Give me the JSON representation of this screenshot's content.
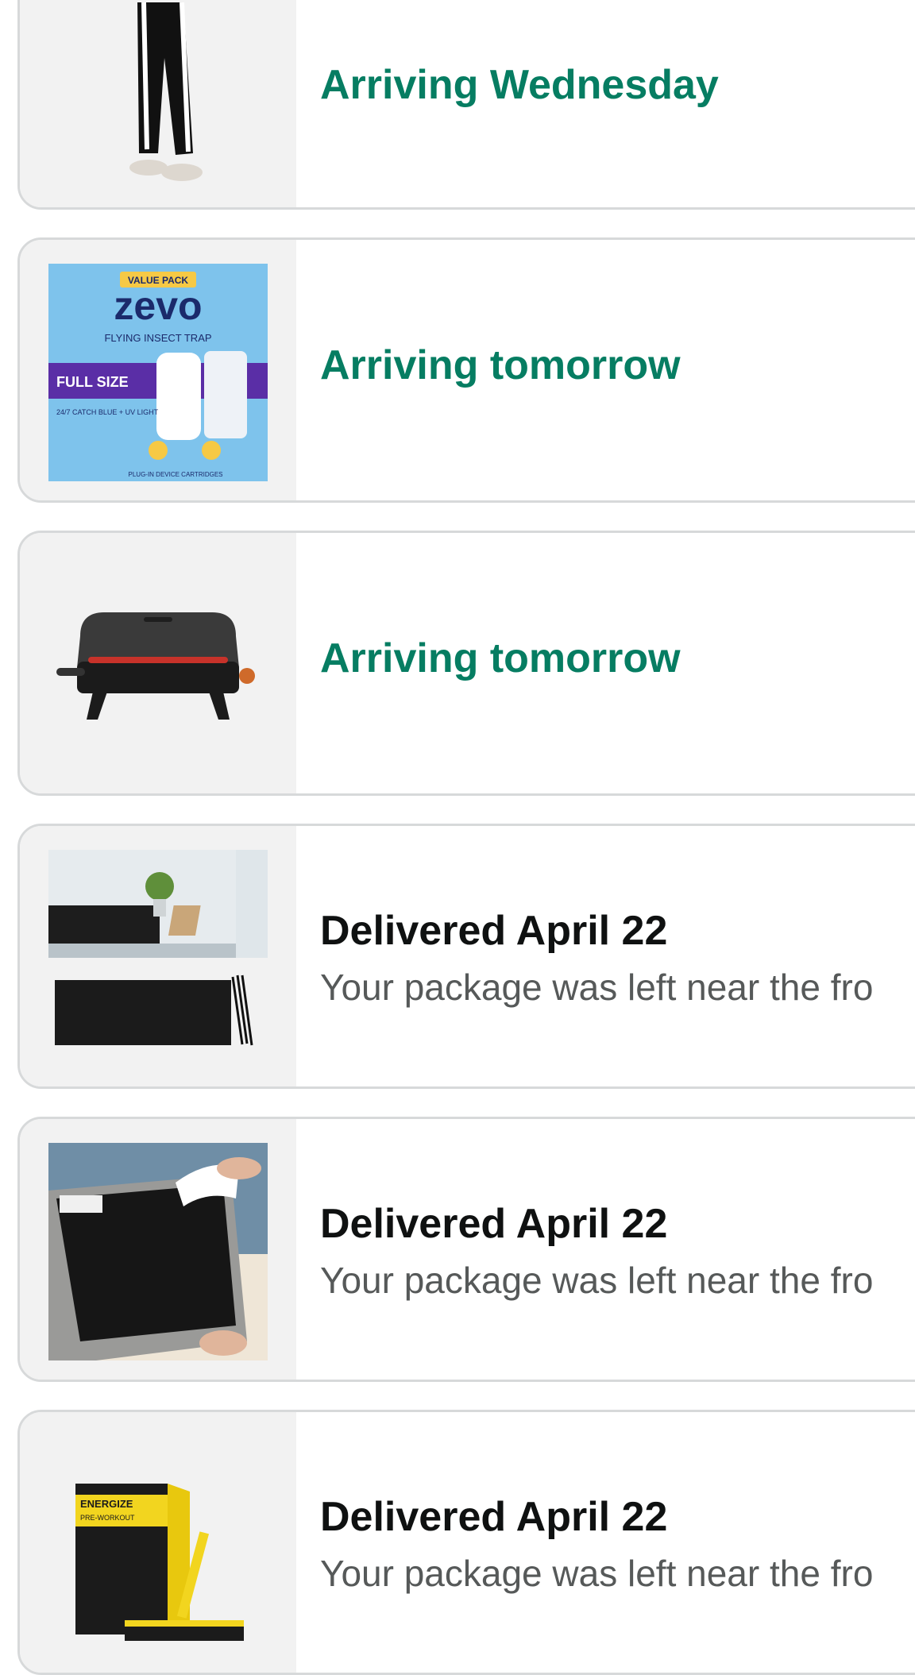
{
  "orders": [
    {
      "status": "Arriving Wednesday",
      "kind": "arriving",
      "image": "pants-product-image"
    },
    {
      "status": "Arriving tomorrow",
      "kind": "arriving",
      "image": "insect-trap-product-image",
      "image_text": {
        "top": "VALUE PACK",
        "brand": "zevo",
        "tag": "FLYING INSECT TRAP",
        "size": "FULL SIZE",
        "catch": "24/7 CATCH BLUE + UV LIGHT",
        "device": "PLUG-IN DEVICE CARTRIDGES"
      }
    },
    {
      "status": "Arriving tomorrow",
      "kind": "arriving",
      "image": "grill-product-image"
    },
    {
      "status": "Delivered April 22",
      "kind": "delivered",
      "detail": "Your package was left near the fro",
      "image": "balcony-screen-product-image"
    },
    {
      "status": "Delivered April 22",
      "kind": "delivered",
      "detail": "Your package was left near the fro",
      "image": "rug-gripper-product-image"
    },
    {
      "status": "Delivered April 22",
      "kind": "delivered",
      "detail": "Your package was left near the fro",
      "image": "preworkout-product-image",
      "image_text": {
        "title": "ENERGIZE",
        "subtitle": "PRE-WORKOUT"
      }
    }
  ],
  "colors": {
    "arriving": "#067d62",
    "delivered": "#0f1111",
    "detail": "#565959",
    "border": "#d7d9da"
  }
}
